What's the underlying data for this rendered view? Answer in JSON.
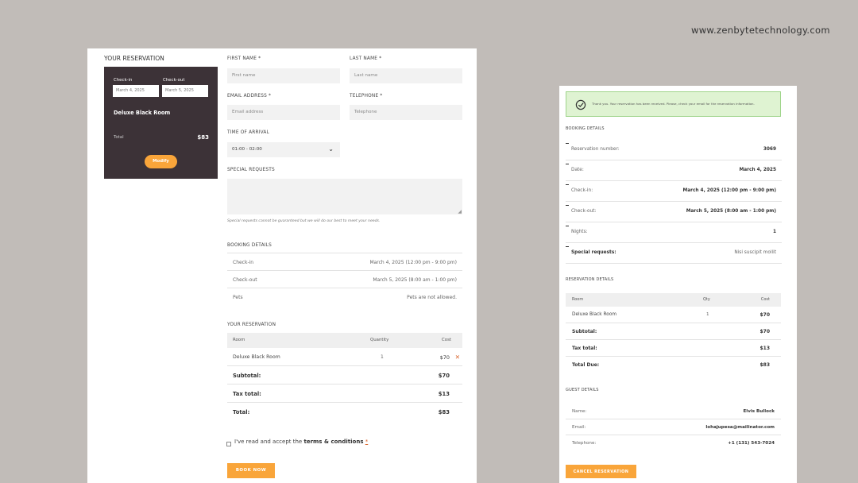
{
  "watermark": "www.zenbytetechnology.com",
  "left": {
    "your_reservation_title": "YOUR RESERVATION",
    "summary": {
      "checkin_label": "Check-in",
      "checkout_label": "Check-out",
      "checkin_value": "March 4, 2025",
      "checkout_value": "March 5, 2025",
      "room": "Deluxe Black Room",
      "total_label": "Total",
      "total_value": "$83",
      "modify_label": "Modify"
    },
    "form": {
      "first_name_label": "FIRST NAME *",
      "first_name_placeholder": "First name",
      "last_name_label": "LAST NAME *",
      "last_name_placeholder": "Last name",
      "email_label": "EMAIL ADDRESS *",
      "email_placeholder": "Email address",
      "telephone_label": "TELEPHONE *",
      "telephone_placeholder": "Telephone",
      "arrival_label": "TIME OF ARRIVAL",
      "arrival_value": "01:00 - 02:00",
      "special_label": "SPECIAL REQUESTS",
      "special_note": "Special requests cannot be guaranteed but we will do our best to meet your needs."
    },
    "booking_details": {
      "title": "BOOKING DETAILS",
      "rows": [
        {
          "label": "Check-in",
          "value": "March 4, 2025 (12:00 pm - 9:00 pm)"
        },
        {
          "label": "Check-out",
          "value": "March 5, 2025 (8:00 am - 1:00 pm)"
        },
        {
          "label": "Pets",
          "value": "Pets are not allowed."
        }
      ]
    },
    "reservation_table": {
      "title": "YOUR RESERVATION",
      "headers": [
        "Room",
        "Quantity",
        "Cost"
      ],
      "room": "Deluxe Black Room",
      "qty": "1",
      "cost": "$70",
      "remove_glyph": "✕",
      "subtotal_label": "Subtotal:",
      "subtotal_value": "$70",
      "tax_label": "Tax total:",
      "tax_value": "$13",
      "total_label": "Total:",
      "total_value": "$83"
    },
    "terms": {
      "prefix": "I've read and accept the ",
      "link": "terms & conditions",
      "asterisk": "*"
    },
    "book_now": "BOOK NOW"
  },
  "right": {
    "notice": "Thank you. Your reservation has been received. Please, check your email for the reservation information.",
    "booking_details_title": "BOOKING DETAILS",
    "details": [
      {
        "label": "Reservation number:",
        "value": "3069"
      },
      {
        "label": "Date:",
        "value": "March 4, 2025"
      },
      {
        "label": "Check-in:",
        "value": "March 4, 2025 (12:00 pm - 9:00 pm)"
      },
      {
        "label": "Check-out:",
        "value": "March 5, 2025 (8:00 am - 1:00 pm)"
      },
      {
        "label": "Nights:",
        "value": "1"
      },
      {
        "label": "Special requests:",
        "value": "Nisi suscipit mollit"
      }
    ],
    "reservation_details_title": "RESERVATION DETAILS",
    "res_headers": [
      "Room",
      "Qty",
      "Cost"
    ],
    "res_room": "Deluxe Black Room",
    "res_qty": "1",
    "res_cost": "$70",
    "subtotal_label": "Subtotal:",
    "subtotal_value": "$70",
    "tax_label": "Tax total:",
    "tax_value": "$13",
    "total_due_label": "Total Due:",
    "total_due_value": "$83",
    "guest_details_title": "GUEST DETAILS",
    "guest": [
      {
        "label": "Name:",
        "value": "Elvis Bullock"
      },
      {
        "label": "Email:",
        "value": "lohajupesa@mailinator.com"
      },
      {
        "label": "Telephone:",
        "value": "+1 (131) 543-7024"
      }
    ],
    "cancel_label": "CANCEL RESERVATION"
  },
  "colors": {
    "accent": "#f9a53a",
    "summary_bg": "#3c3237",
    "notice_bg": "#dff3d2",
    "notice_border": "#9fd48a",
    "remove": "#d9652b"
  }
}
